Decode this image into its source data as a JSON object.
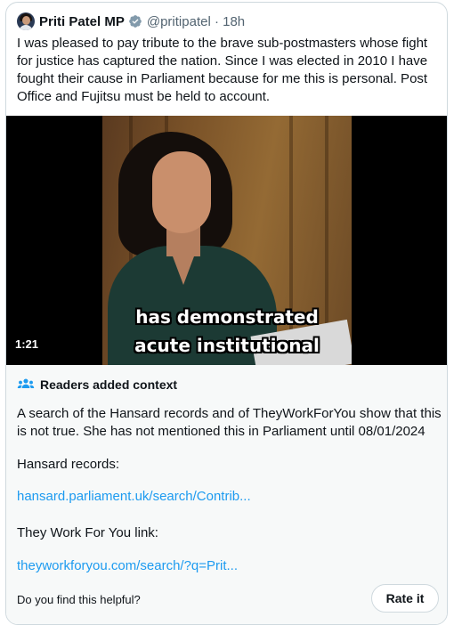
{
  "tweet": {
    "author_name": "Priti Patel MP",
    "handle_time": "@pritipatel · 18h",
    "text": "I was pleased to pay tribute to the brave sub-postmasters whose fight for justice has captured the nation. Since I was elected in 2010 I have fought their cause in Parliament because for me this is personal. Post Office and Fujitsu must be held to account.",
    "verified_icon": "verified-badge-icon"
  },
  "video": {
    "caption_line1": "has demonstrated",
    "caption_line2": "acute institutional",
    "duration": "1:21"
  },
  "note": {
    "title": "Readers added context",
    "icon": "people-icon",
    "body": "A search of the Hansard records and of TheyWorkForYou show that this is not true. She has not mentioned this in Parliament until 08/01/2024",
    "hansard_label": "Hansard records:",
    "hansard_link": "hansard.parliament.uk/search/Contrib...",
    "twfy_label": "They Work For You link:",
    "twfy_link": "theyworkforyou.com/search/?q=Prit...",
    "helpful_question": "Do you find this helpful?",
    "rate_button": "Rate it"
  },
  "colors": {
    "link": "#1d9bf0",
    "secondary_text": "#536471",
    "notes_bg": "#f7f9f9",
    "border": "#cfd9de"
  }
}
